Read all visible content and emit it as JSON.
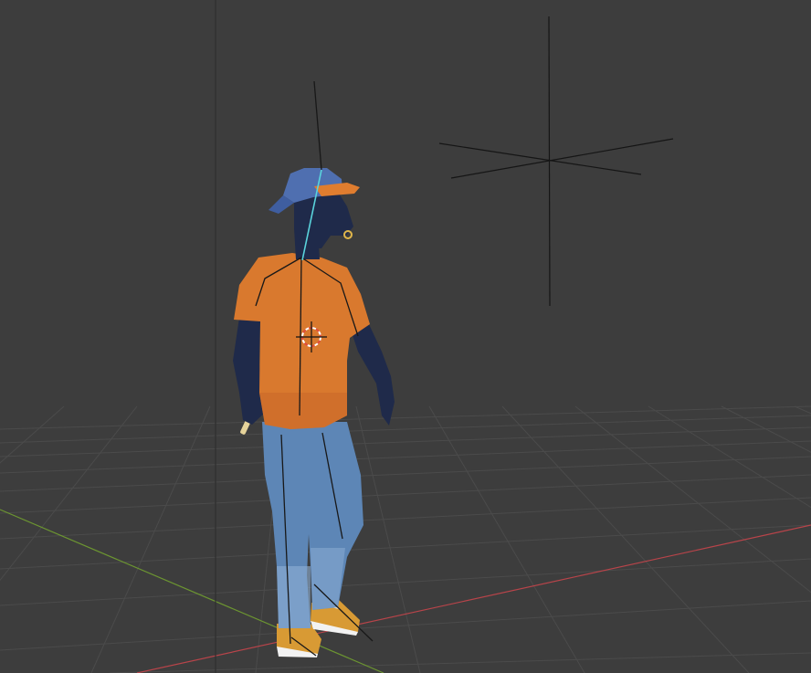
{
  "viewport": {
    "background_color": "#3d3d3d",
    "grid_color": "#4a4a4a",
    "x_axis_color": "#c6464c",
    "y_axis_color": "#6f9a2f"
  },
  "scene_objects": [
    {
      "name": "character",
      "type": "armature-mesh",
      "selected": false
    },
    {
      "name": "light",
      "type": "light-gizmo"
    },
    {
      "name": "3d-cursor",
      "type": "cursor"
    }
  ],
  "character_colors": {
    "skin": "#1f2a4a",
    "shirt": "#d9792e",
    "jeans": "#5d86b6",
    "cap": "#4f6fb0",
    "cap_brim": "#e07d2f",
    "shoes": "#d89a34",
    "rig_line": "#1a1a1a",
    "selected_bone": "#5ad3dc"
  }
}
